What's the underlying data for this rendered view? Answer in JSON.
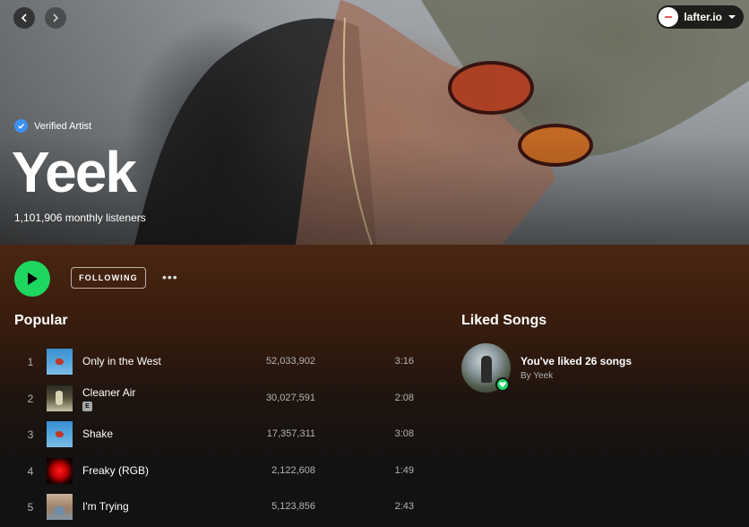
{
  "nav": {
    "back_icon": "chevron-left-icon",
    "forward_icon": "chevron-right-icon"
  },
  "user": {
    "name": "lafter.io",
    "menu_icon": "caret-down-icon"
  },
  "artist": {
    "verified_label": "Verified Artist",
    "name": "Yeek",
    "listeners": "1,101,906 monthly listeners"
  },
  "actions": {
    "play_icon": "play-icon",
    "follow_label": "FOLLOWING",
    "more_label": "•••"
  },
  "popular": {
    "title": "Popular",
    "tracks": [
      {
        "num": "1",
        "title": "Only in the West",
        "explicit": "",
        "plays": "52,033,902",
        "duration": "3:16",
        "art": "art-blue"
      },
      {
        "num": "2",
        "title": "Cleaner Air",
        "explicit": "E",
        "plays": "30,027,591",
        "duration": "2:08",
        "art": "art-dark"
      },
      {
        "num": "3",
        "title": "Shake",
        "explicit": "",
        "plays": "17,357,311",
        "duration": "3:08",
        "art": "art-blue"
      },
      {
        "num": "4",
        "title": "Freaky (RGB)",
        "explicit": "",
        "plays": "2,122,608",
        "duration": "1:49",
        "art": "art-red"
      },
      {
        "num": "5",
        "title": "I'm Trying",
        "explicit": "",
        "plays": "5,123,856",
        "duration": "2:43",
        "art": "art-tan"
      }
    ]
  },
  "liked": {
    "title": "Liked Songs",
    "line1": "You've liked 26 songs",
    "line2": "By Yeek"
  },
  "colors": {
    "accent_green": "#1ed760",
    "verified_blue": "#3d91f4",
    "background": "#121212"
  }
}
